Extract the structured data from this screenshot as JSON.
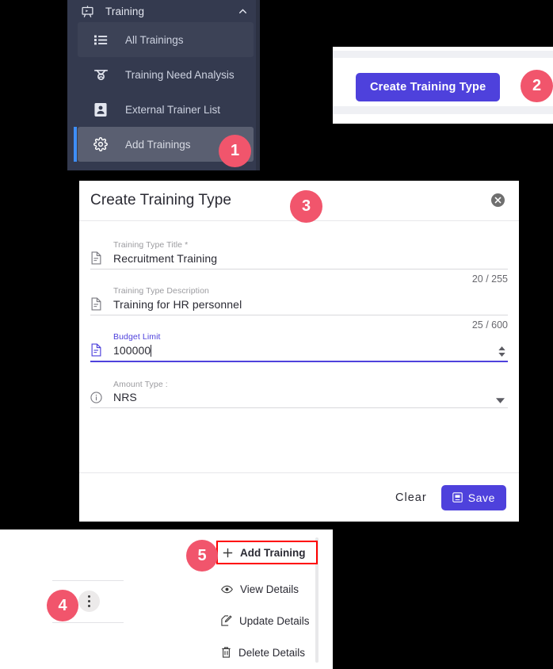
{
  "colors": {
    "badge": "#f1556c",
    "primary": "#4e41dc",
    "sidebar_bg": "#343a4f",
    "sidebar_active_bg": "#5a5f71",
    "sidebar_accent": "#3e8ef7",
    "highlight_outline": "#ff0000"
  },
  "badges": [
    {
      "number": "1"
    },
    {
      "number": "2"
    },
    {
      "number": "3"
    },
    {
      "number": "4"
    },
    {
      "number": "5"
    }
  ],
  "sidebar": {
    "header": {
      "label": "Training",
      "icon": "presentation-board-icon",
      "chevron": "chevron-up-icon"
    },
    "items": [
      {
        "label": "All Trainings",
        "icon": "list-icon",
        "state": "hovered"
      },
      {
        "label": "Training Need Analysis",
        "icon": "analysis-icon",
        "state": "normal"
      },
      {
        "label": "External Trainer List",
        "icon": "contact-card-icon",
        "state": "normal"
      },
      {
        "label": "Add Trainings",
        "icon": "gear-icon",
        "state": "active"
      }
    ]
  },
  "toolbar": {
    "create_button_label": "Create Training Type"
  },
  "modal": {
    "title": "Create Training Type",
    "close_icon": "close-circle-icon",
    "fields": [
      {
        "label": "Training Type Title *",
        "value": "Recruitment Training",
        "icon": "document-icon",
        "counter": "20 / 255",
        "focused": false
      },
      {
        "label": "Training Type Description",
        "value": "Training for HR personnel",
        "icon": "document-icon",
        "counter": "25 / 600",
        "focused": false
      },
      {
        "label": "Budget Limit",
        "value": "100000",
        "icon": "document-icon",
        "counter": "",
        "focused": true
      }
    ],
    "select": {
      "label": "Amount Type :",
      "value": "NRS",
      "icon": "info-circle-icon",
      "arrow": "chevron-down-icon"
    },
    "footer": {
      "clear_label": "Clear",
      "save_label": "Save",
      "save_icon": "save-disk-icon"
    }
  },
  "context_menu": {
    "trigger_icon": "more-vertical-icon",
    "items": [
      {
        "label": "Add Training",
        "icon": "plus-icon",
        "highlighted": true
      },
      {
        "label": "View Details",
        "icon": "eye-icon",
        "highlighted": false
      },
      {
        "label": "Update Details",
        "icon": "edit-pencil-icon",
        "highlighted": false
      },
      {
        "label": "Delete Details",
        "icon": "trash-icon",
        "highlighted": false
      }
    ]
  }
}
